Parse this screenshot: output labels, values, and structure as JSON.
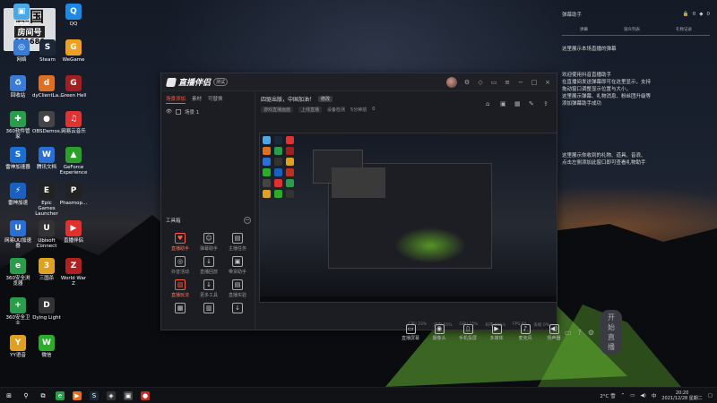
{
  "desktop": {
    "overlay": {
      "line1": "三国",
      "line2": "房间号",
      "line3": "901686"
    },
    "icons": [
      {
        "label": "此电脑",
        "glyph": "▣",
        "color": "#4aa8e8"
      },
      {
        "label": "Steam",
        "glyph": "S",
        "color": "#1b2838"
      },
      {
        "label": "QQ",
        "glyph": "Q",
        "color": "#1e88e5"
      },
      {
        "label": "WeGame",
        "glyph": "G",
        "color": "#f0a020"
      },
      {
        "label": "网络",
        "glyph": "◎",
        "color": "#3a7bd5"
      },
      {
        "label": "回收站",
        "glyph": "♻",
        "color": "#3a7bd5"
      },
      {
        "label": "dyClientLa...",
        "glyph": "d",
        "color": "#e07020"
      },
      {
        "label": "Green Hell",
        "glyph": "G",
        "color": "#a02020"
      },
      {
        "label": "360软件管家",
        "glyph": "✚",
        "color": "#2a9d4a"
      },
      {
        "label": "OBSDemos...",
        "glyph": "●",
        "color": "#444"
      },
      {
        "label": "网易云音乐",
        "glyph": "♫",
        "color": "#d33"
      },
      {
        "label": "雷神加速器",
        "glyph": "S",
        "color": "#1a6fd0"
      },
      {
        "label": "腾讯文档",
        "glyph": "W",
        "color": "#2a6fd6"
      },
      {
        "label": "GeForce Experience",
        "glyph": "▲",
        "color": "#2aa02a"
      },
      {
        "label": "雷神加速",
        "glyph": "⚡",
        "color": "#1a60c0"
      },
      {
        "label": "Epic Games Launcher",
        "glyph": "E",
        "color": "#222"
      },
      {
        "label": "Phasmop...",
        "glyph": "P",
        "color": "#222"
      },
      {
        "label": "网易UU加速器",
        "glyph": "U",
        "color": "#2a6fd6"
      },
      {
        "label": "Ubisoft Connect",
        "glyph": "U",
        "color": "#333"
      },
      {
        "label": "直播伴侣",
        "glyph": "▶",
        "color": "#e03030"
      },
      {
        "label": "360安全浏览器",
        "glyph": "e",
        "color": "#2a9d4a"
      },
      {
        "label": "三国杀",
        "glyph": "3",
        "color": "#e0a020"
      },
      {
        "label": "World War Z",
        "glyph": "Z",
        "color": "#b02020"
      },
      {
        "label": "360安全卫士",
        "glyph": "+",
        "color": "#2a9d4a"
      },
      {
        "label": "Dying Light",
        "glyph": "D",
        "color": "#333"
      },
      {
        "label": "YY语音",
        "glyph": "Y",
        "color": "#e0a020"
      },
      {
        "label": "微信",
        "glyph": "W",
        "color": "#2aae2a"
      }
    ]
  },
  "window": {
    "app_name": "直播伴侣",
    "version_tag": "测试",
    "left_tabs": [
      "场景添加",
      "素材",
      "可替换"
    ],
    "scene_label": "场景 1",
    "tools_title": "工具箱",
    "tools": [
      {
        "label": "直播助手",
        "glyph": "♥",
        "hot": true
      },
      {
        "label": "弹幕助手",
        "glyph": "☺",
        "hot": false
      },
      {
        "label": "主播任务",
        "glyph": "▤",
        "hot": false
      },
      {
        "label": "抖音活动",
        "glyph": "◎",
        "hot": false
      },
      {
        "label": "直播回放",
        "glyph": "↓",
        "hot": false
      },
      {
        "label": "带货助手",
        "glyph": "▣",
        "hot": false
      },
      {
        "label": "直播玩法",
        "glyph": "▧",
        "hot": true
      },
      {
        "label": "更多工具",
        "glyph": "↓",
        "hot": false
      },
      {
        "label": "直播实验",
        "glyph": "▤",
        "hot": false
      },
      {
        "label": "",
        "glyph": "▦",
        "hot": false
      },
      {
        "label": "",
        "glyph": "▥",
        "hot": false
      },
      {
        "label": "",
        "glyph": "↓",
        "hot": false
      }
    ],
    "stream_title": "四驱出版，中国加油！",
    "stream_title_tag": "修改",
    "stream_meta": [
      "游戏直播画面",
      "上线直播",
      "设备检测",
      "5分钟前",
      "0"
    ],
    "controls": [
      {
        "label": "直播屏幕",
        "glyph": "▭"
      },
      {
        "label": "摄像头",
        "glyph": "◉"
      },
      {
        "label": "手机投屏",
        "glyph": "▯"
      },
      {
        "label": "多媒体",
        "glyph": "▶"
      },
      {
        "label": "麦克风",
        "glyph": "♪"
      },
      {
        "label": "扬声器",
        "glyph": "◀)"
      }
    ],
    "start_label": "开始直播",
    "status": [
      "CPU 23%",
      "内存 55%",
      "GPU 15%",
      "码率 0kb/s",
      "FPS 60",
      "丢帧 0%"
    ]
  },
  "chat": {
    "header": "弹幕助手",
    "header_right": [
      "0",
      "0"
    ],
    "columns": [
      "弹幕",
      "观众列表",
      "礼物记录"
    ],
    "line1": "这里展示本场直播的弹幕",
    "block1": [
      "欢迎使用抖音直播助手",
      "在直播间发送弹幕即可在这里显示，支持",
      "拖动窗口调整显示位置与大小，",
      "这里展示弹幕、礼物消息、粉丝团升级等",
      "添加弹幕助手成功"
    ],
    "block2": [
      "这里展示你收到的礼物、道具、音浪、",
      "点击左侧添加此窗口即可查看礼物助手"
    ]
  },
  "taskbar": {
    "icons": [
      {
        "name": "start-icon",
        "glyph": "⊞",
        "color": "#101216"
      },
      {
        "name": "search-icon",
        "glyph": "⚲",
        "color": "#101216"
      },
      {
        "name": "task-view-icon",
        "glyph": "⧉",
        "color": "#101216"
      },
      {
        "name": "browser-icon",
        "glyph": "e",
        "color": "#2a9d4a"
      },
      {
        "name": "livestream-app-icon",
        "glyph": "▶",
        "color": "#e07020"
      },
      {
        "name": "steam-icon",
        "glyph": "S",
        "color": "#1b2838"
      },
      {
        "name": "game-icon",
        "glyph": "◈",
        "color": "#333"
      },
      {
        "name": "app-icon",
        "glyph": "▣",
        "color": "#444"
      },
      {
        "name": "red-app-icon",
        "glyph": "●",
        "color": "#c03020"
      }
    ],
    "weather": "2°C 雪",
    "time": "20:20",
    "date": "2021/12/28 星期二"
  }
}
